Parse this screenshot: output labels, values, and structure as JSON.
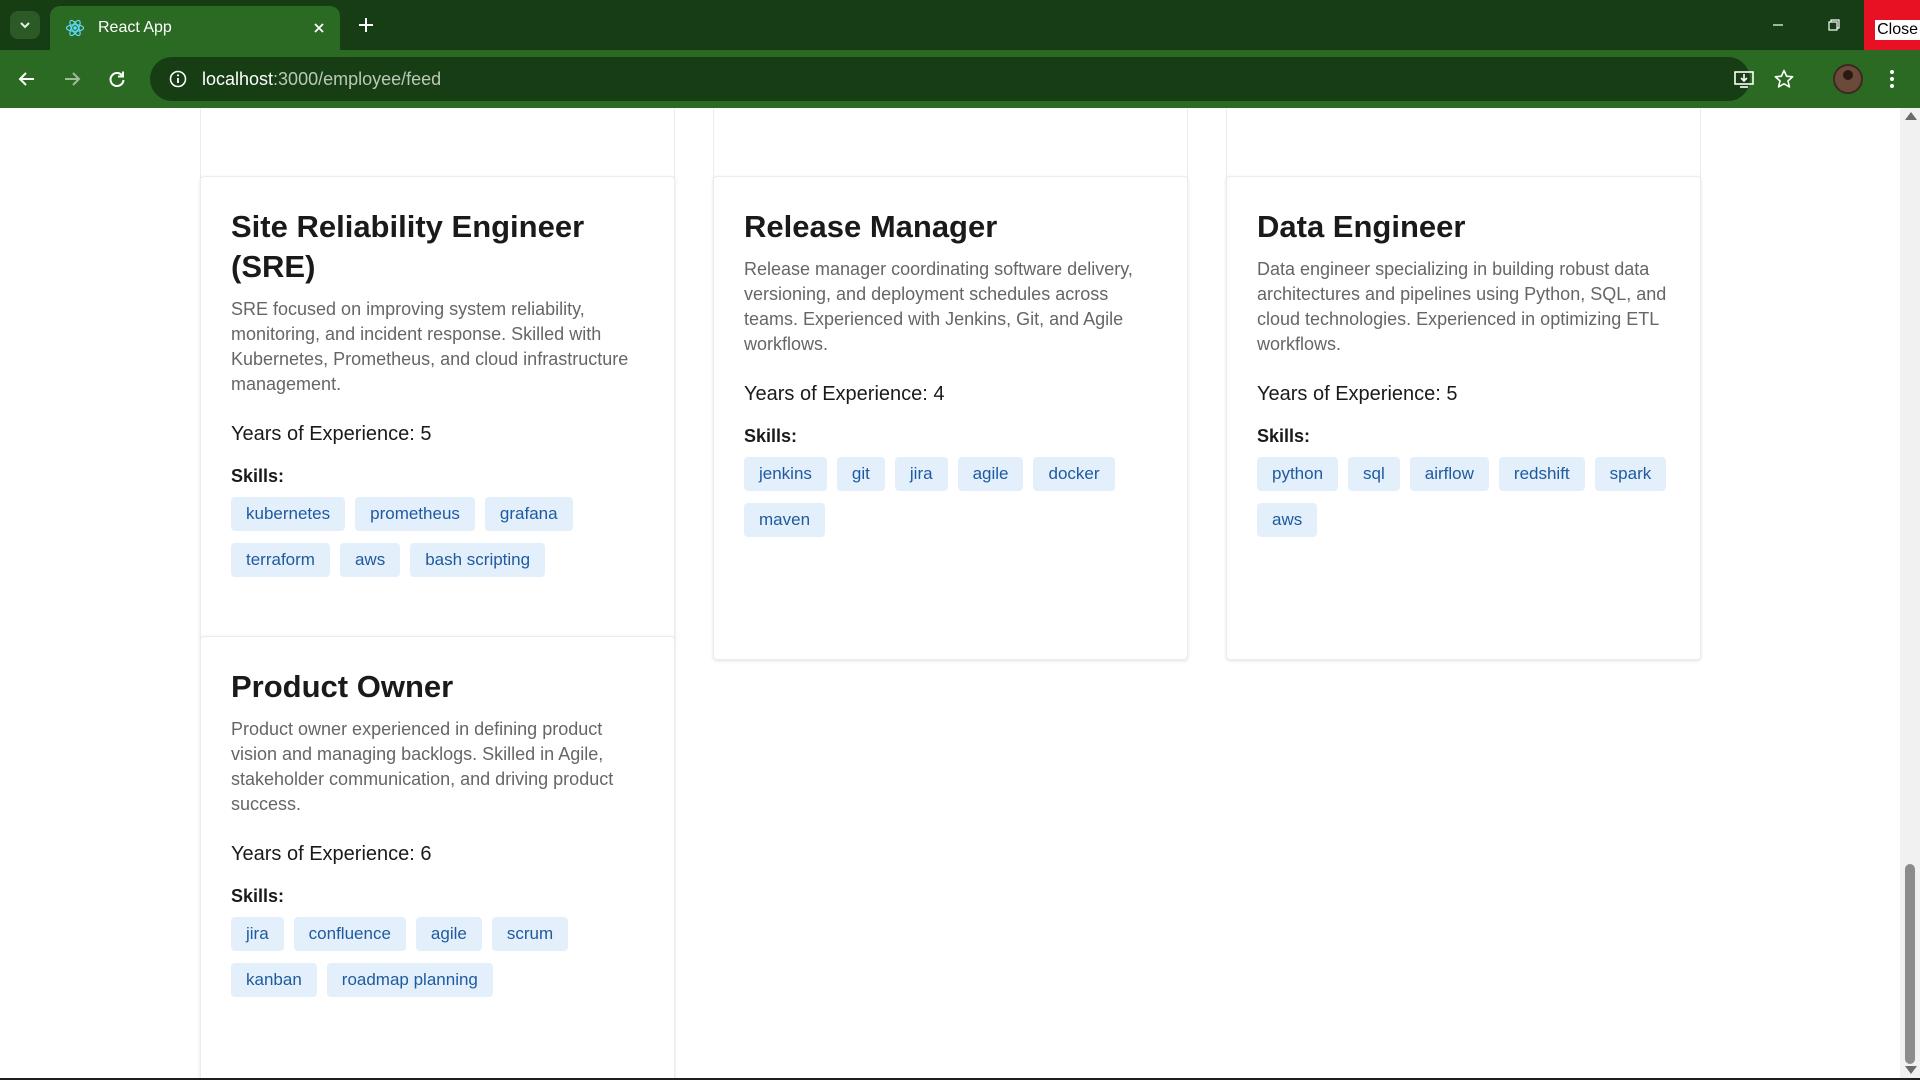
{
  "browser": {
    "tab_title": "React App",
    "url_host": "localhost",
    "url_path": ":3000/employee/feed",
    "close_badge": "Close"
  },
  "cards": [
    {
      "title": "Site Reliability Engineer (SRE)",
      "description": "SRE focused on improving system reliability, monitoring, and incident response. Skilled with Kubernetes, Prometheus, and cloud infrastructure management.",
      "experience": "Years of Experience: 5",
      "skills_label": "Skills:",
      "skills": [
        "kubernetes",
        "prometheus",
        "grafana",
        "terraform",
        "aws",
        "bash scripting"
      ]
    },
    {
      "title": "Release Manager",
      "description": "Release manager coordinating software delivery, versioning, and deployment schedules across teams. Experienced with Jenkins, Git, and Agile workflows.",
      "experience": "Years of Experience: 4",
      "skills_label": "Skills:",
      "skills": [
        "jenkins",
        "git",
        "jira",
        "agile",
        "docker",
        "maven"
      ]
    },
    {
      "title": "Data Engineer",
      "description": "Data engineer specializing in building robust data architectures and pipelines using Python, SQL, and cloud technologies. Experienced in optimizing ETL workflows.",
      "experience": "Years of Experience: 5",
      "skills_label": "Skills:",
      "skills": [
        "python",
        "sql",
        "airflow",
        "redshift",
        "spark",
        "aws"
      ]
    },
    {
      "title": "Product Owner",
      "description": "Product owner experienced in defining product vision and managing backlogs. Skilled in Agile, stakeholder communication, and driving product success.",
      "experience": "Years of Experience: 6",
      "skills_label": "Skills:",
      "skills": [
        "jira",
        "confluence",
        "agile",
        "scrum",
        "kanban",
        "roadmap planning"
      ]
    }
  ]
}
